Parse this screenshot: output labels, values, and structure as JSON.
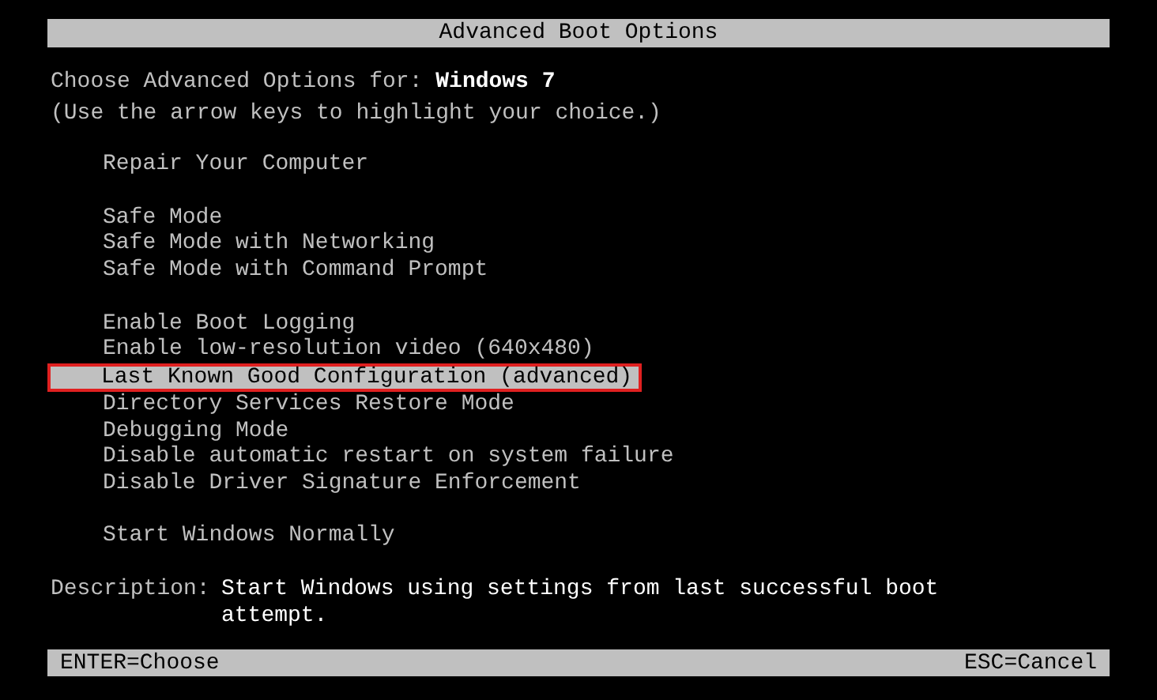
{
  "title": "Advanced Boot Options",
  "prompt": {
    "text": "Choose Advanced Options for: ",
    "os": "Windows 7"
  },
  "hint": "(Use the arrow keys to highlight your choice.)",
  "groups": [
    [
      {
        "label": "Repair Your Computer",
        "selected": false
      }
    ],
    [
      {
        "label": "Safe Mode",
        "selected": false
      },
      {
        "label": "Safe Mode with Networking",
        "selected": false
      },
      {
        "label": "Safe Mode with Command Prompt",
        "selected": false
      }
    ],
    [
      {
        "label": "Enable Boot Logging",
        "selected": false
      },
      {
        "label": "Enable low-resolution video (640x480)",
        "selected": false
      },
      {
        "label": "Last Known Good Configuration (advanced)",
        "selected": true
      },
      {
        "label": "Directory Services Restore Mode",
        "selected": false
      },
      {
        "label": "Debugging Mode",
        "selected": false
      },
      {
        "label": "Disable automatic restart on system failure",
        "selected": false
      },
      {
        "label": "Disable Driver Signature Enforcement",
        "selected": false
      }
    ],
    [
      {
        "label": "Start Windows Normally",
        "selected": false
      }
    ]
  ],
  "description": {
    "label": "Description:",
    "lines": [
      "Start Windows using settings from last successful boot",
      "attempt."
    ]
  },
  "status_bar": {
    "left": "ENTER=Choose",
    "right": "ESC=Cancel"
  }
}
